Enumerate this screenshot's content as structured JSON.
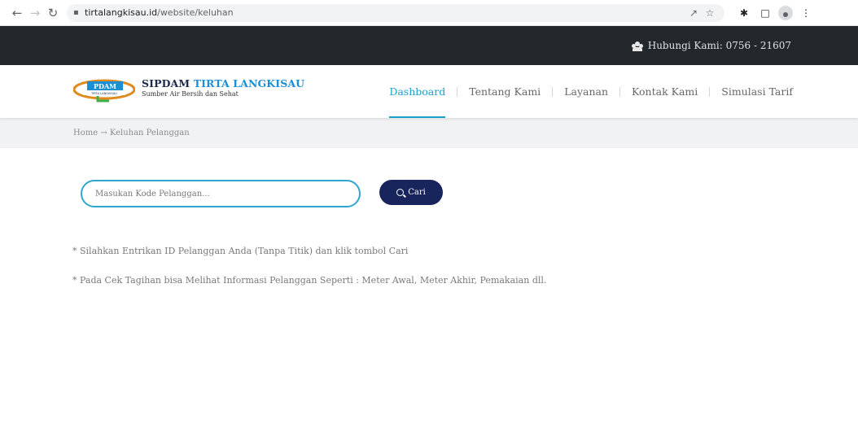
{
  "browser": {
    "url_host": "tirtalangkisau.id",
    "url_path": "/website/keluhan"
  },
  "topbar": {
    "contact_text": "Hubungi Kami: 0756 - 21607"
  },
  "brand": {
    "title_main": "SIPDAM",
    "title_accent": "TIRTA LANGKISAU",
    "subtitle": "Sumber Air Bersih dan Sehat",
    "logo_text": "PDAM",
    "logo_text_small": "TIRTA LANGKISAU"
  },
  "menu": {
    "items": [
      {
        "label": "Dashboard",
        "active": true
      },
      {
        "label": "Tentang Kami",
        "active": false
      },
      {
        "label": "Layanan",
        "active": false
      },
      {
        "label": "Kontak Kami",
        "active": false
      },
      {
        "label": "Simulasi Tarif",
        "active": false
      }
    ]
  },
  "breadcrumb": {
    "text": "Home → Keluhan Pelanggan"
  },
  "search": {
    "placeholder": "Masukan Kode Pelanggan...",
    "button_label": "Cari"
  },
  "notes": [
    "* Silahkan Entrikan ID Pelanggan Anda (Tanpa Titik) dan klik tombol Cari",
    "* Pada Cek Tagihan bisa Melihat Informasi Pelanggan Seperti : Meter Awal, Meter Akhir, Pemakaian dll."
  ],
  "colors": {
    "topbar_bg": "#23282d",
    "accent": "#1aa0c9",
    "button_bg": "#18245c",
    "brand_blue": "#1b8fd6"
  }
}
